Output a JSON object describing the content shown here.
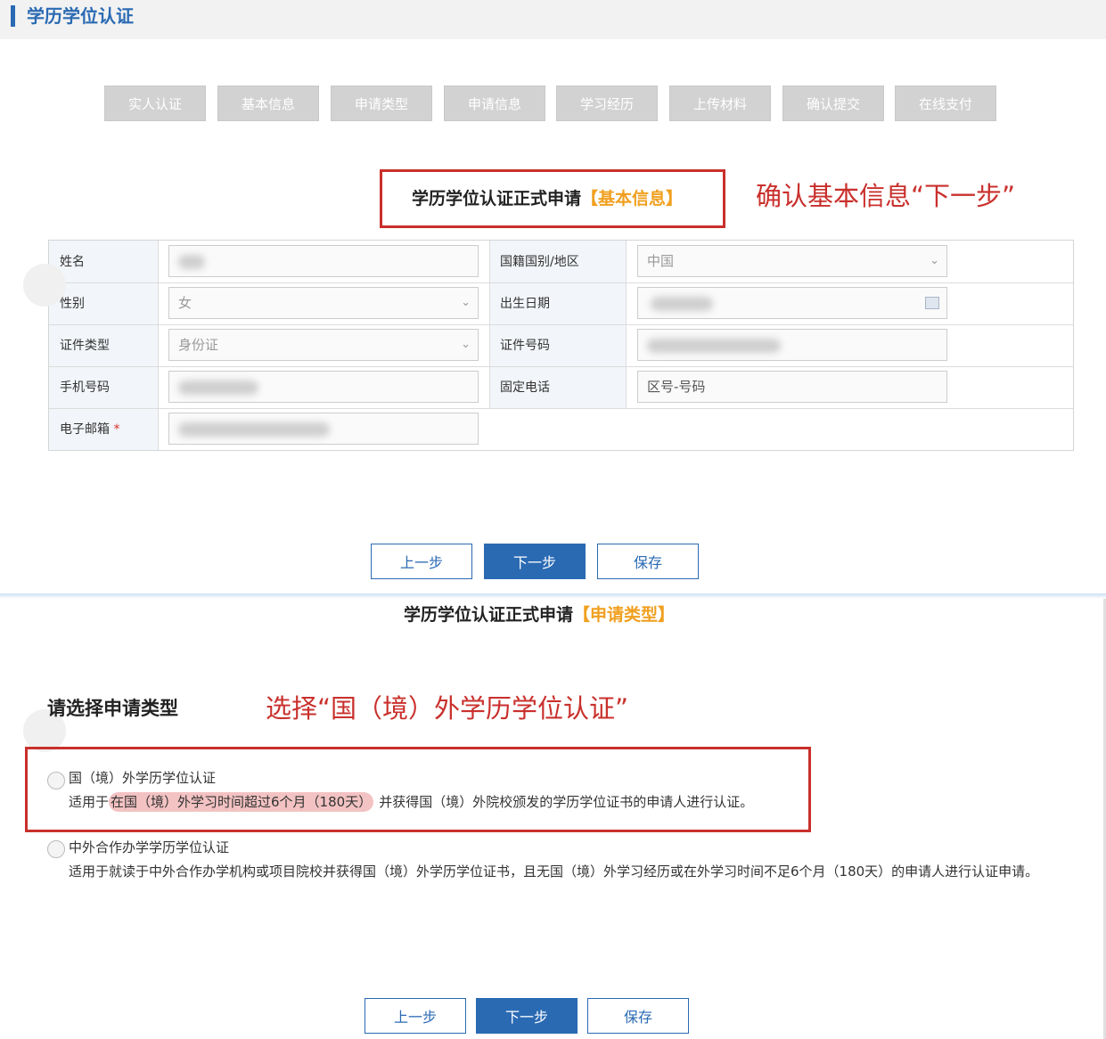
{
  "header": {
    "title": "学历学位认证"
  },
  "steps": [
    "实人认证",
    "基本信息",
    "申请类型",
    "申请信息",
    "学习经历",
    "上传材料",
    "确认提交",
    "在线支付"
  ],
  "basic_section": {
    "title": "学历学位认证正式申请",
    "tag": "【基本信息】",
    "annotation": "确认基本信息“下一步”"
  },
  "form": {
    "name_label": "姓名",
    "nationality_label": "国籍国别/地区",
    "nationality_value": "中国",
    "gender_label": "性别",
    "gender_value": "女",
    "birth_label": "出生日期",
    "id_type_label": "证件类型",
    "id_type_value": "身份证",
    "id_number_label": "证件号码",
    "mobile_label": "手机号码",
    "landline_label": "固定电话",
    "landline_placeholder": "区号-号码",
    "email_label": "电子邮箱",
    "required_mark": "*"
  },
  "buttons": {
    "prev": "上一步",
    "next": "下一步",
    "save": "保存"
  },
  "type_section": {
    "title": "学历学位认证正式申请",
    "tag": "【申请类型】",
    "choose_label": "请选择申请类型",
    "annotation": "选择“国（境）外学历学位认证”",
    "options": [
      {
        "label": "国（境）外学历学位认证",
        "desc_prefix": "适用于",
        "desc_highlight": "在国（境）外学习时间超过6个月（180天）",
        "desc_suffix": "并获得国（境）外院校颁发的学历学位证书的申请人进行认证。"
      },
      {
        "label": "中外合作办学学历学位认证",
        "desc": "适用于就读于中外合作办学机构或项目院校并获得国（境）外学历学位证书，且无国（境）外学习经历或在外学习时间不足6个月（180天）的申请人进行认证申请。"
      }
    ]
  },
  "colors": {
    "accent": "#2a6ab3",
    "annotation": "#c9302c",
    "tag": "#f0a020"
  }
}
